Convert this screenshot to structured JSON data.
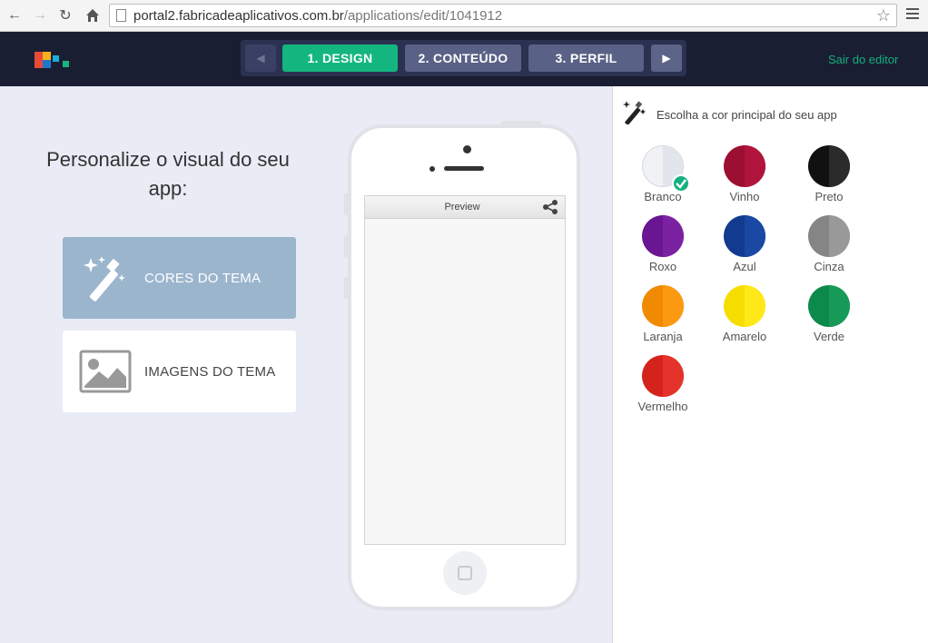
{
  "browser": {
    "url_host": "portal2.fabricadeaplicativos.com.br",
    "url_path": "/applications/edit/1041912"
  },
  "header": {
    "steps": [
      {
        "label": "1. DESIGN",
        "active": true
      },
      {
        "label": "2. CONTEÚDO",
        "active": false
      },
      {
        "label": "3. PERFIL",
        "active": false
      }
    ],
    "exit_label": "Sair do editor",
    "colors": {
      "active": "#14b67f",
      "inactive": "#5a6186",
      "bar": "#1a1e33"
    }
  },
  "left": {
    "title": "Personalize o visual do seu app:",
    "options": [
      {
        "label": "CORES DO TEMA",
        "icon": "magic-wand-icon",
        "selected": true
      },
      {
        "label": "IMAGENS DO TEMA",
        "icon": "image-icon",
        "selected": false
      }
    ]
  },
  "phone": {
    "header_title": "Preview"
  },
  "right": {
    "title": "Escolha a cor principal do seu app",
    "swatches": [
      {
        "name": "Branco",
        "left": "#f1f2f6",
        "right": "#e3e5ec",
        "selected": true
      },
      {
        "name": "Vinho",
        "left": "#9c0f32",
        "right": "#b0143c",
        "selected": false
      },
      {
        "name": "Preto",
        "left": "#111111",
        "right": "#2b2b2b",
        "selected": false
      },
      {
        "name": "Roxo",
        "left": "#6a1591",
        "right": "#7b22a2",
        "selected": false
      },
      {
        "name": "Azul",
        "left": "#123a8e",
        "right": "#1b48a3",
        "selected": false
      },
      {
        "name": "Cinza",
        "left": "#858585",
        "right": "#999999",
        "selected": false
      },
      {
        "name": "Laranja",
        "left": "#f08a00",
        "right": "#fb9a11",
        "selected": false
      },
      {
        "name": "Amarelo",
        "left": "#f6dd00",
        "right": "#ffe817",
        "selected": false
      },
      {
        "name": "Verde",
        "left": "#0c8a4c",
        "right": "#179a58",
        "selected": false
      },
      {
        "name": "Vermelho",
        "left": "#d4221d",
        "right": "#e5332b",
        "selected": false
      }
    ]
  }
}
